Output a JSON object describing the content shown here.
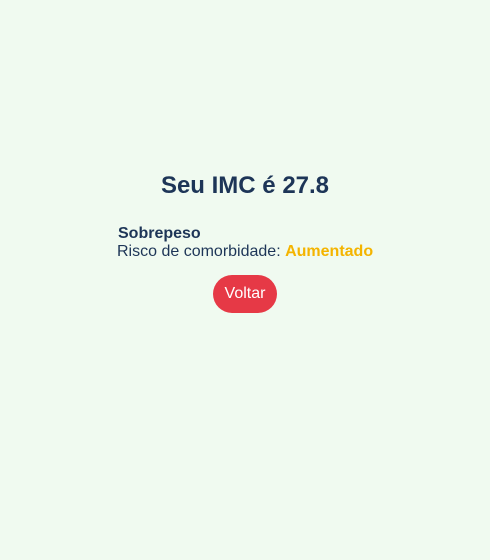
{
  "result": {
    "title": "Seu IMC é 27.8",
    "category": "Sobrepeso",
    "risk_label": "Risco de comorbidade: ",
    "risk_value": "Aumentado",
    "back_label": "Voltar"
  },
  "colors": {
    "background": "#f0faf0",
    "text": "#1d3557",
    "risk_accent": "#f4b400",
    "button": "#e63946",
    "button_text": "#ffffff"
  }
}
